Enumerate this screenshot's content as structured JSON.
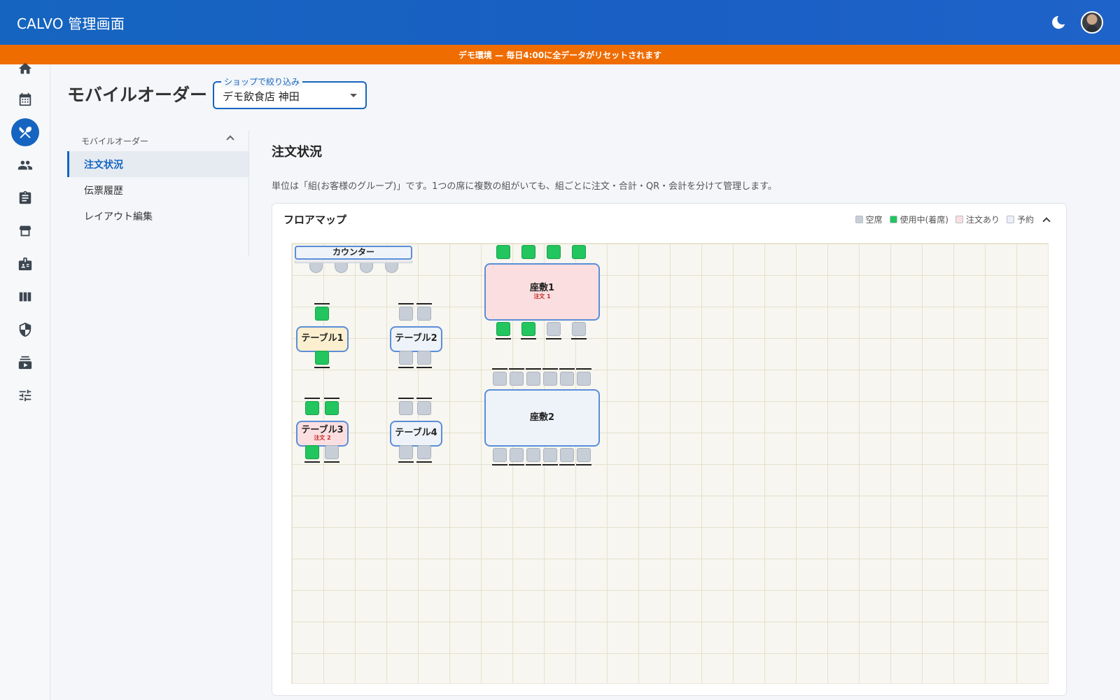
{
  "header": {
    "app_title": "CALVO 管理画面",
    "theme_icon": "moon-icon",
    "avatar_icon": "user-avatar"
  },
  "banner": {
    "text": "デモ環境 — 毎日4:00に全データがリセットされます",
    "color": "#ef6c00"
  },
  "rail": {
    "items": [
      {
        "icon": "home-icon"
      },
      {
        "icon": "calendar-icon"
      },
      {
        "icon": "restaurant-icon",
        "active": true
      },
      {
        "icon": "people-icon"
      },
      {
        "icon": "clipboard-icon"
      },
      {
        "icon": "store-icon"
      },
      {
        "icon": "badge-icon"
      },
      {
        "icon": "columns-icon"
      },
      {
        "icon": "shield-icon"
      },
      {
        "icon": "subscriptions-icon"
      },
      {
        "icon": "tune-icon"
      }
    ]
  },
  "page": {
    "title": "モバイルオーダー",
    "shop_filter": {
      "label": "ショップで絞り込み",
      "value": "デモ飲食店 神田"
    }
  },
  "sub_nav": {
    "header": "モバイルオーダー",
    "items": [
      {
        "label": "注文状況",
        "active": true
      },
      {
        "label": "伝票履歴"
      },
      {
        "label": "レイアウト編集"
      }
    ]
  },
  "main": {
    "section_title": "注文状況",
    "description": "単位は「組(お客様のグループ)」です。1つの席に複数の組がいても、組ごとに注文・合計・QR・会計を分けて管理します。"
  },
  "floor_map": {
    "title": "フロアマップ",
    "legend": [
      {
        "label": "空席",
        "color": "#c7ced8"
      },
      {
        "label": "使用中(着席)",
        "color": "#22c55e"
      },
      {
        "label": "注文あり",
        "color": "#fbdfe0"
      },
      {
        "label": "予約",
        "color": "#eceef8"
      }
    ],
    "counter": {
      "name": "カウンター",
      "stools": 4
    },
    "tables": [
      {
        "name": "テーブル1",
        "state": "used",
        "top_seats": [
          "used"
        ],
        "bottom_seats": [
          "used"
        ]
      },
      {
        "name": "テーブル2",
        "state": "vacant",
        "top_seats": [
          "empty",
          "empty"
        ],
        "bottom_seats": [
          "empty",
          "empty"
        ]
      },
      {
        "name": "テーブル3",
        "state": "order",
        "badge": "注文 2",
        "top_seats": [
          "used",
          "used"
        ],
        "bottom_seats": [
          "used",
          "empty"
        ]
      },
      {
        "name": "テーブル4",
        "state": "vacant",
        "top_seats": [
          "empty",
          "empty"
        ],
        "bottom_seats": [
          "empty",
          "empty"
        ]
      },
      {
        "name": "座敷1",
        "state": "order",
        "badge": "注文 1",
        "top_seats": [
          "used",
          "used",
          "used",
          "used"
        ],
        "bottom_seats": [
          "used",
          "used",
          "empty",
          "empty"
        ]
      },
      {
        "name": "座敷2",
        "state": "vacant",
        "top_seats": [
          "empty",
          "empty",
          "empty",
          "empty",
          "empty",
          "empty"
        ],
        "bottom_seats": [
          "empty",
          "empty",
          "empty",
          "empty",
          "empty",
          "empty"
        ]
      }
    ]
  }
}
